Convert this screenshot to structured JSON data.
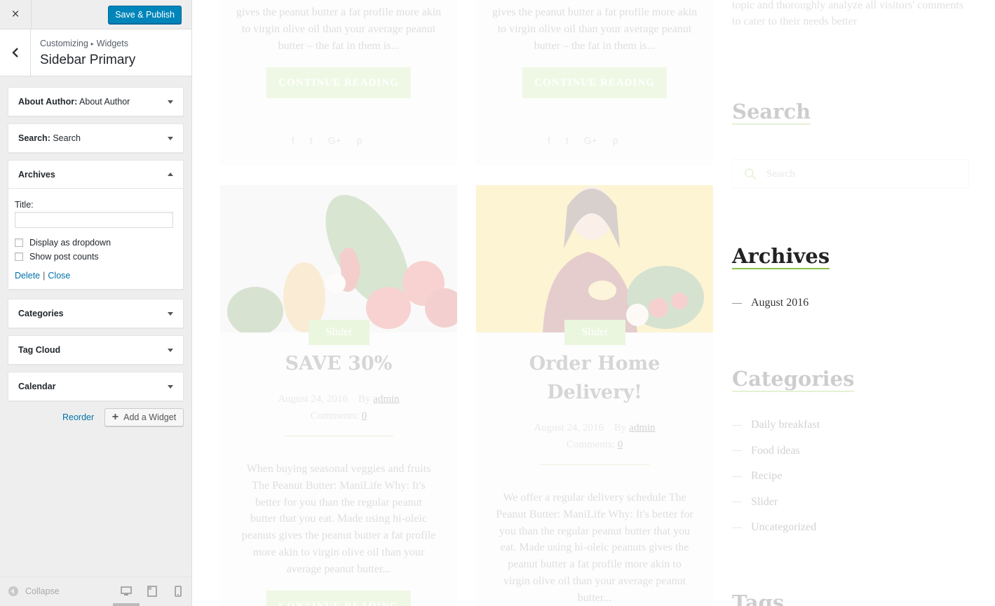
{
  "panel": {
    "close_label": "×",
    "publish_label": "Save & Publish",
    "breadcrumb": [
      "Customizing",
      "Widgets"
    ],
    "section_title": "Sidebar Primary",
    "widgets": [
      {
        "name": "About Author:",
        "sub": "About Author"
      },
      {
        "name": "Search:",
        "sub": "Search"
      },
      {
        "name": "Archives",
        "sub": ""
      },
      {
        "name": "Categories",
        "sub": ""
      },
      {
        "name": "Tag Cloud",
        "sub": ""
      },
      {
        "name": "Calendar",
        "sub": ""
      }
    ],
    "archives_form": {
      "title_label": "Title:",
      "title_value": "",
      "dropdown_label": "Display as dropdown",
      "counts_label": "Show post counts",
      "delete_label": "Delete",
      "pipe": "|",
      "close_label": "Close"
    },
    "reorder_label": "Reorder",
    "add_widget_label": "Add a Widget",
    "collapse_label": "Collapse"
  },
  "preview": {
    "top_excerpt": "gives the peanut butter a fat profile more akin to virgin olive oil than your average peanut butter – the fat in them is...",
    "continue_label": "CONTINUE READING",
    "posts": [
      {
        "badge": "Slider",
        "title": "SAVE 30%",
        "date": "August 24, 2016",
        "by": "By",
        "author": "admin",
        "comments_label": "Comments:",
        "comments": "0",
        "excerpt": "When buying seasonal veggies and fruits The Peanut Butter: ManiLife Why: It's better for you than the regular peanut butter that you eat. Made using hi-oleic peanuts gives the peanut butter a fat profile more akin to virgin olive oil than your average peanut butter..."
      },
      {
        "badge": "Slider",
        "title": "Order Home Delivery!",
        "date": "August 24, 2016",
        "by": "By",
        "author": "admin",
        "comments_label": "Comments:",
        "comments": "0",
        "excerpt": "We offer a regular delivery schedule The Peanut Butter: ManiLife Why: It's better for you than the regular peanut butter that you eat. Made using hi-oleic peanuts gives the peanut butter a fat profile more akin to virgin olive oil than your average peanut butter..."
      }
    ],
    "sidebar": {
      "intro": "topic and thoroughly analyze all visitors' comments to cater to their needs better",
      "search_title": "Search",
      "search_placeholder": "Search",
      "archives_title": "Archives",
      "archives": [
        "August 2016"
      ],
      "categories_title": "Categories",
      "categories": [
        "Daily breakfast",
        "Food ideas",
        "Recipe",
        "Slider",
        "Uncategorized"
      ],
      "tags_title": "Tags"
    }
  },
  "colors": {
    "accent": "#0085ba",
    "link": "#0073aa",
    "green": "#8bc34a"
  }
}
